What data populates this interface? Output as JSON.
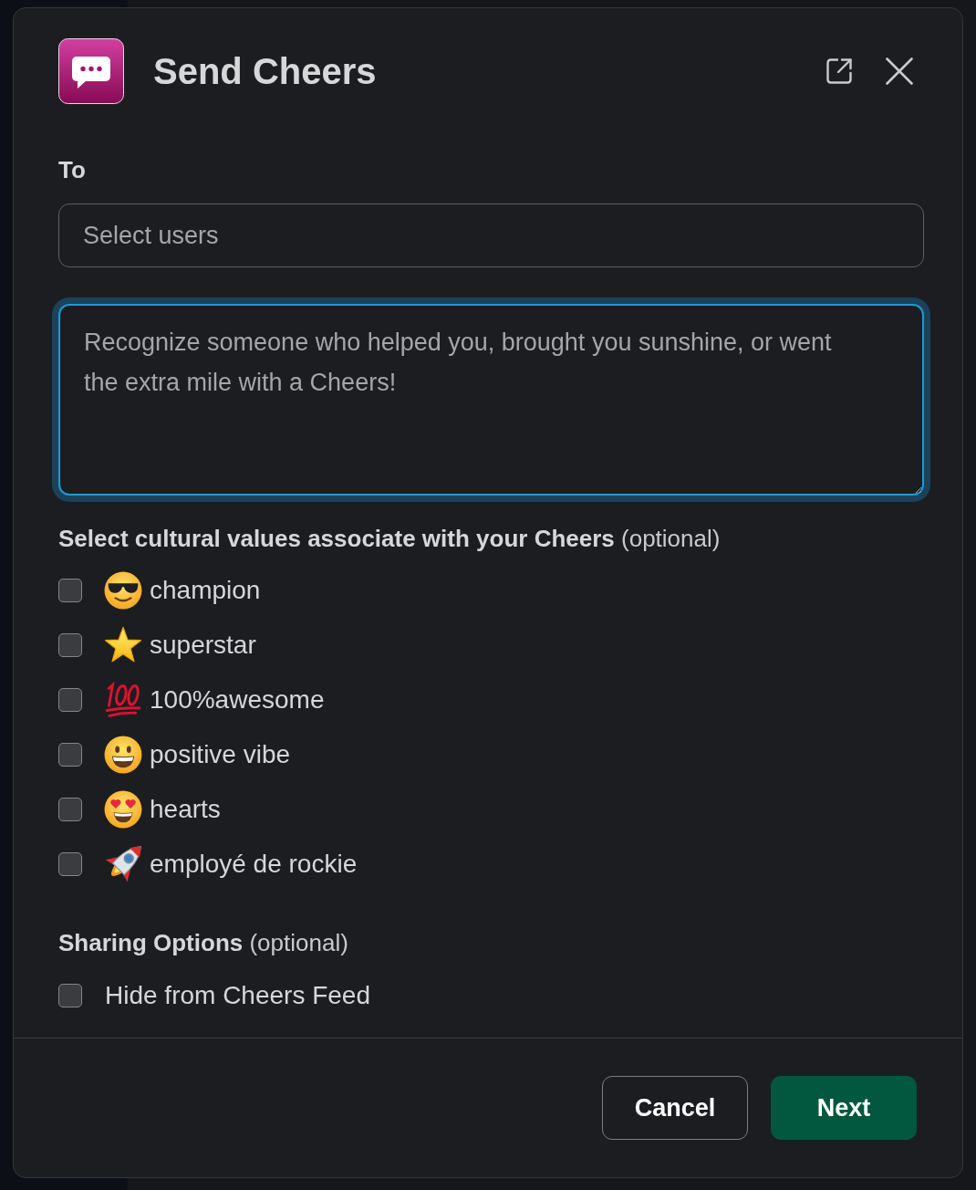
{
  "dialog": {
    "title": "Send Cheers"
  },
  "to": {
    "label": "To",
    "placeholder": "Select users"
  },
  "message": {
    "placeholder": "Recognize someone who helped you, brought you sunshine, or went the extra mile with a Cheers!",
    "focused": true
  },
  "values": {
    "heading": "**Select cultural values associate with your Cheers** (optional)",
    "options": [
      {
        "label": "champion",
        "checked": false
      },
      {
        "label": "superstar",
        "checked": false
      },
      {
        "label": "100%awesome",
        "checked": false
      },
      {
        "label": "positive vibe",
        "checked": false
      },
      {
        "label": "hearts",
        "checked": false
      },
      {
        "label": "employé de rockie",
        "checked": false
      }
    ]
  },
  "sharing": {
    "heading": "**Sharing Options** (optional)",
    "options": [
      {
        "label": "Hide from Cheers Feed",
        "checked": false
      }
    ]
  },
  "buttons": [
    {
      "label": "Cancel",
      "kind": "secondary"
    },
    {
      "label": "Next",
      "kind": "primary"
    }
  ]
}
